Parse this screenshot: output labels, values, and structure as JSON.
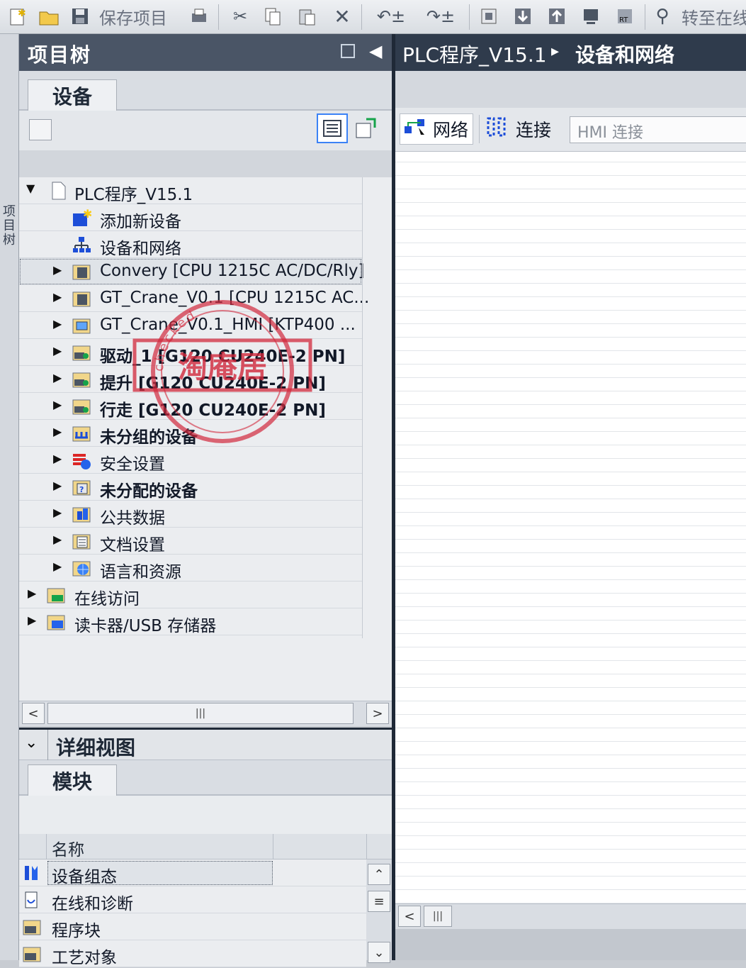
{
  "toolbar": {
    "save_project_label": "保存项目",
    "goto_online_label": "转至在线",
    "icons": [
      "new-project-icon",
      "open-project-icon",
      "save-icon",
      "print-icon",
      "cut-icon",
      "copy-icon",
      "paste-icon",
      "delete-icon",
      "undo-icon",
      "redo-icon",
      "compile-icon",
      "download-icon",
      "upload-icon",
      "simulate-icon",
      "runtime-icon",
      "go-online-icon"
    ]
  },
  "left_strip": {
    "vertical_label": "项目树"
  },
  "project_tree": {
    "title": "项目树",
    "tab": "设备",
    "items": [
      {
        "label": "PLC程序_V15.1",
        "icon": "project-icon",
        "bold": false
      },
      {
        "label": "添加新设备",
        "icon": "add-device-icon",
        "bold": false
      },
      {
        "label": "设备和网络",
        "icon": "network-icon",
        "bold": false
      },
      {
        "label": "Convery [CPU 1215C AC/DC/Rly]",
        "icon": "cpu-icon",
        "bold": false
      },
      {
        "label": "GT_Crane_V0.1 [CPU 1215C AC...",
        "icon": "cpu-icon",
        "bold": false
      },
      {
        "label": "GT_Crane_V0.1_HMI [KTP400 ...",
        "icon": "hmi-icon",
        "bold": false
      },
      {
        "label": "驱动_1 [G120 CU240E-2 PN]",
        "icon": "drive-icon",
        "bold": true
      },
      {
        "label": "提升 [G120 CU240E-2 PN]",
        "icon": "drive-icon",
        "bold": true
      },
      {
        "label": "行走 [G120 CU240E-2 PN]",
        "icon": "drive-icon",
        "bold": true
      },
      {
        "label": "未分组的设备",
        "icon": "ungrouped-devices-icon",
        "bold": true
      },
      {
        "label": "安全设置",
        "icon": "security-icon",
        "bold": false
      },
      {
        "label": "未分配的设备",
        "icon": "unassigned-devices-icon",
        "bold": true
      },
      {
        "label": "公共数据",
        "icon": "common-data-icon",
        "bold": false
      },
      {
        "label": "文档设置",
        "icon": "document-settings-icon",
        "bold": false
      },
      {
        "label": "语言和资源",
        "icon": "languages-icon",
        "bold": false
      },
      {
        "label": "在线访问",
        "icon": "online-access-icon",
        "bold": false
      },
      {
        "label": "读卡器/USB 存储器",
        "icon": "card-reader-icon",
        "bold": false
      }
    ]
  },
  "details_view": {
    "title": "详细视图",
    "tab": "模块",
    "column_name": "名称",
    "rows": [
      {
        "label": "设备组态",
        "icon": "device-config-icon"
      },
      {
        "label": "在线和诊断",
        "icon": "diagnostics-icon"
      },
      {
        "label": "程序块",
        "icon": "program-blocks-icon"
      },
      {
        "label": "工艺对象",
        "icon": "technology-objects-icon"
      }
    ]
  },
  "editor": {
    "breadcrumb_project": "PLC程序_V15.1",
    "breadcrumb_sep": "▸",
    "breadcrumb_page": "设备和网络",
    "network_label": "网络",
    "connections_label": "连接",
    "connection_type_value": "HMI 连接"
  },
  "stamp": {
    "center_text": "淘庵居",
    "ring_text": "checked"
  },
  "colors": {
    "header_dark": "#4a5566",
    "breadcrumb_bg": "#2f3b4c",
    "stamp": "#d2283c"
  }
}
